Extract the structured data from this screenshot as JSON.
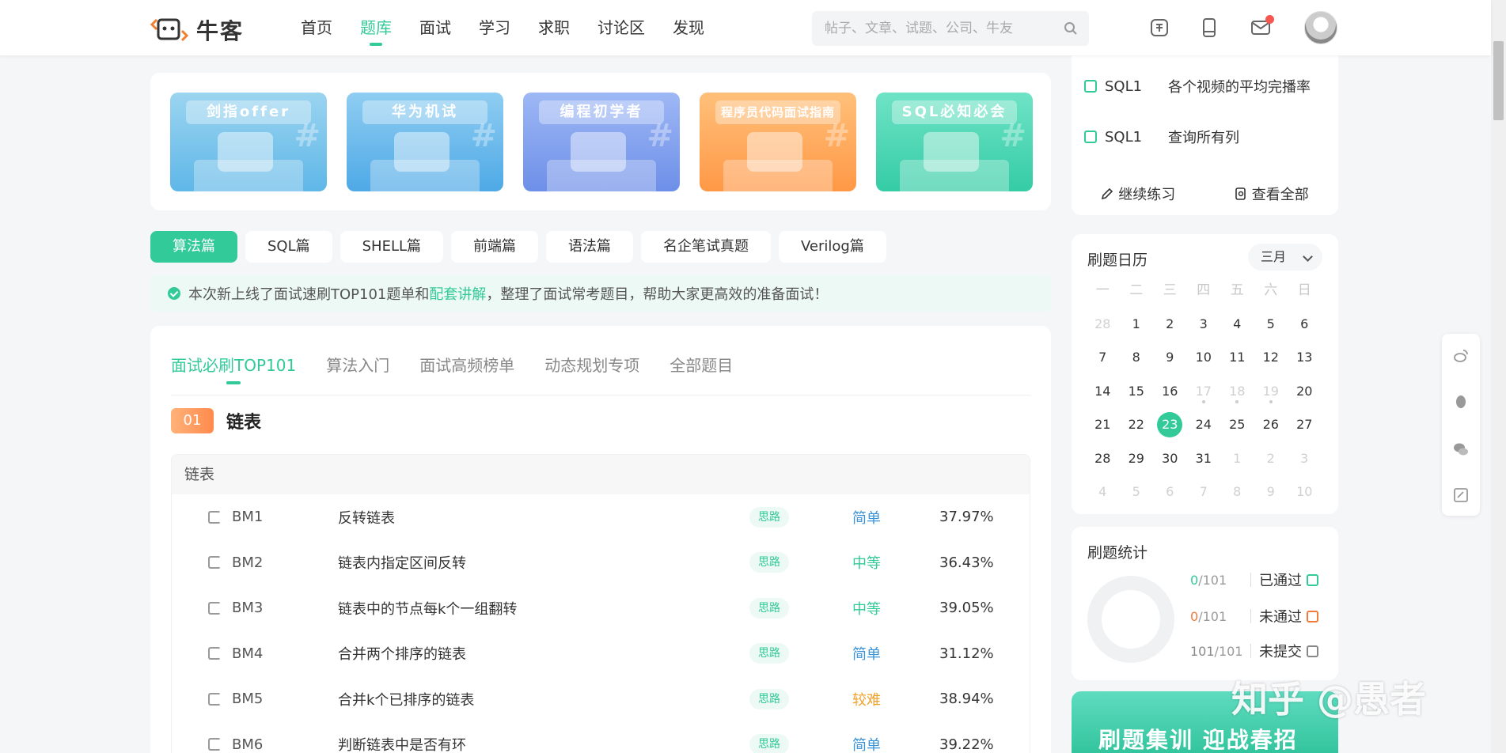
{
  "logo": {
    "text": "牛客"
  },
  "nav": [
    "首页",
    "题库",
    "面试",
    "学习",
    "求职",
    "讨论区",
    "发现"
  ],
  "search": {
    "placeholder": "帖子、文章、试题、公司、牛友"
  },
  "icons": {
    "search": "search-icon",
    "recruit": "recruit-icon",
    "app": "phone-icon",
    "mail": "mail-icon"
  },
  "banners": [
    {
      "title": "剑指offer",
      "color": "#9bd4f0",
      "accent": "#5fb7e8"
    },
    {
      "title": "华为机试",
      "color": "#8fcdf2",
      "accent": "#4ea9e6"
    },
    {
      "title": "编程初学者",
      "color": "#9eb8f5",
      "accent": "#6d8fe8"
    },
    {
      "title": "程序员代码面试指南",
      "color": "#ffc07a",
      "accent": "#ff9846"
    },
    {
      "title": "SQL必知必会",
      "color": "#6fe3c6",
      "accent": "#34cca5"
    }
  ],
  "pills": [
    "算法篇",
    "SQL篇",
    "SHELL篇",
    "前端篇",
    "语法篇",
    "名企笔试真题",
    "Verilog篇"
  ],
  "notice": {
    "before": "本次新上线了面试速刷TOP101题单和",
    "link": "配套讲解",
    "after": "，整理了面试常考题目，帮助大家更高效的准备面试！"
  },
  "tabs": [
    "面试必刷TOP101",
    "算法入门",
    "面试高频榜单",
    "动态规划专项",
    "全部题目"
  ],
  "section": {
    "num": "01",
    "title": "链表"
  },
  "list": {
    "head": "链表",
    "rows": [
      {
        "code": "BM1",
        "name": "反转链表",
        "hint": "思路",
        "diff": "简单",
        "rate": "37.97%",
        "diff_color": "#3a93d8"
      },
      {
        "code": "BM2",
        "name": "链表内指定区间反转",
        "hint": "思路",
        "diff": "中等",
        "rate": "36.43%",
        "diff_color": "#32ca99"
      },
      {
        "code": "BM3",
        "name": "链表中的节点每k个一组翻转",
        "hint": "思路",
        "diff": "中等",
        "rate": "39.05%",
        "diff_color": "#32ca99"
      },
      {
        "code": "BM4",
        "name": "合并两个排序的链表",
        "hint": "思路",
        "diff": "简单",
        "rate": "31.12%",
        "diff_color": "#3a93d8"
      },
      {
        "code": "BM5",
        "name": "合并k个已排序的链表",
        "hint": "思路",
        "diff": "较难",
        "rate": "38.94%",
        "diff_color": "#f0a12c"
      },
      {
        "code": "BM6",
        "name": "判断链表中是否有环",
        "hint": "思路",
        "diff": "简单",
        "rate": "39.22%",
        "diff_color": "#3a93d8"
      }
    ]
  },
  "recent": {
    "items": [
      {
        "code": "SQL1",
        "name": "各个视频的平均完播率"
      },
      {
        "code": "SQL1",
        "name": "查询所有列"
      }
    ],
    "continue": "继续练习",
    "view_all": "查看全部"
  },
  "calendar": {
    "title": "刷题日历",
    "month": "三月",
    "weekdays": [
      "一",
      "二",
      "三",
      "四",
      "五",
      "六",
      "日"
    ],
    "days": [
      "28",
      "1",
      "2",
      "3",
      "4",
      "5",
      "6",
      "7",
      "8",
      "9",
      "10",
      "11",
      "12",
      "13",
      "14",
      "15",
      "16",
      "17",
      "18",
      "19",
      "20",
      "21",
      "22",
      "23",
      "24",
      "25",
      "26",
      "27",
      "28",
      "29",
      "30",
      "31",
      "1",
      "2",
      "3",
      "4",
      "5",
      "6",
      "7",
      "8",
      "9",
      "10"
    ],
    "today_index": 23
  },
  "stats": {
    "title": "刷题统计",
    "rows": [
      {
        "count": "0",
        "total": "/101",
        "label": "已通过",
        "color": "#32ca99"
      },
      {
        "count": "0",
        "total": "/101",
        "label": "未通过",
        "color": "#f07b3a"
      },
      {
        "count": "101",
        "total": "/101",
        "label": "未提交",
        "color": "#888888"
      }
    ]
  },
  "promo": {
    "text": "刷题集训 迎战春招"
  },
  "watermark": "知乎 @愚者",
  "colors": {
    "accent": "#32ca99",
    "orange": "#ff8a4c",
    "blue": "#3a93d8"
  }
}
